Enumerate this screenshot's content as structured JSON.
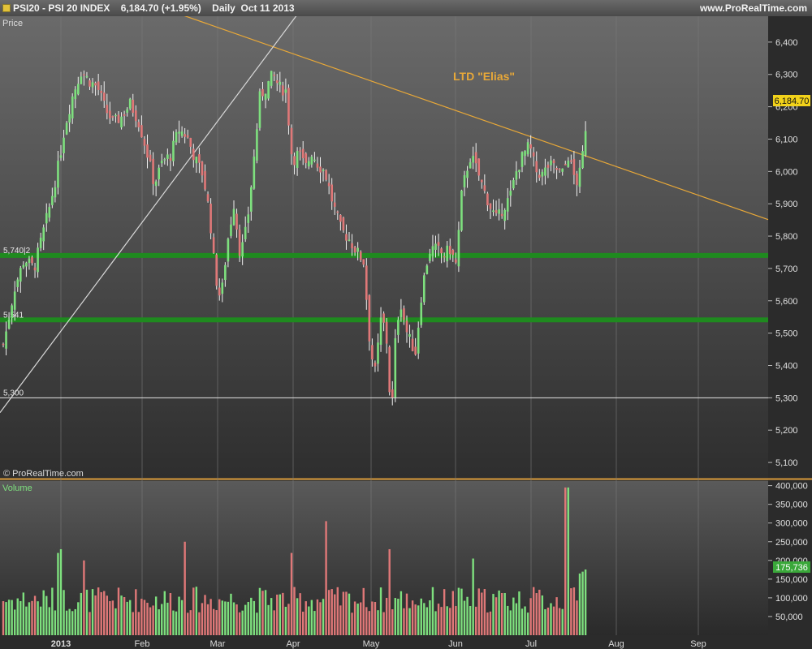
{
  "header": {
    "title": "PSI20 - PSI 20 INDEX",
    "last": "6,184.70 (+1.95%)",
    "period": "Daily  Oct 11 2013",
    "site": "www.ProRealTime.com"
  },
  "panels": {
    "price_label": "Price",
    "volume_label": "Volume",
    "watermark": "© ProRealTime.com",
    "annotation": "LTD \"Elias\""
  },
  "colors": {
    "up": "#7ee07e",
    "down": "#e07878",
    "support": "#1f8a1f",
    "trendline": "#e8a838",
    "uptrend": "#d8d8d8",
    "last_badge": "#f2d21a",
    "vol_badge": "#3aa83a"
  },
  "chart_data": [
    {
      "type": "candlestick",
      "title": "PSI20 - PSI 20 INDEX",
      "ylabel": "Price",
      "ylim": [
        5050,
        6480
      ],
      "y_ticks": [
        5100,
        5200,
        5300,
        5400,
        5500,
        5600,
        5700,
        5800,
        5900,
        6000,
        6100,
        6200,
        6300,
        6400
      ],
      "y_tick_labels": [
        "5,100",
        "5,200",
        "5,300",
        "5,400",
        "5,500",
        "5,600",
        "5,700",
        "5,800",
        "5,900",
        "6,000",
        "6,100",
        "6,200",
        "6,300",
        "6,400"
      ],
      "x_labels": [
        "2013",
        "Feb",
        "Mar",
        "Apr",
        "May",
        "Jun",
        "Jul",
        "Aug",
        "Sep"
      ],
      "last_value": 6184.7,
      "last_value_label": "6,184.70",
      "levels": [
        {
          "value": 5740.2,
          "label": "5,740|2",
          "style": "support"
        },
        {
          "value": 5541,
          "label": "5,541",
          "style": "support"
        },
        {
          "value": 5300,
          "label": "5,300",
          "style": "thin"
        }
      ],
      "close_path": [
        [
          0,
          5420
        ],
        [
          8,
          5510
        ],
        [
          18,
          5640
        ],
        [
          30,
          5730
        ],
        [
          42,
          5700
        ],
        [
          52,
          5800
        ],
        [
          62,
          5900
        ],
        [
          72,
          6020
        ],
        [
          80,
          6140
        ],
        [
          90,
          6240
        ],
        [
          100,
          6310
        ],
        [
          110,
          6280
        ],
        [
          120,
          6260
        ],
        [
          130,
          6190
        ],
        [
          140,
          6150
        ],
        [
          150,
          6170
        ],
        [
          160,
          6210
        ],
        [
          170,
          6160
        ],
        [
          180,
          6070
        ],
        [
          190,
          5960
        ],
        [
          200,
          6030
        ],
        [
          210,
          6050
        ],
        [
          220,
          6130
        ],
        [
          230,
          6110
        ],
        [
          240,
          6040
        ],
        [
          250,
          5990
        ],
        [
          258,
          5870
        ],
        [
          265,
          5680
        ],
        [
          272,
          5600
        ],
        [
          280,
          5780
        ],
        [
          288,
          5900
        ],
        [
          296,
          5740
        ],
        [
          304,
          5830
        ],
        [
          312,
          6020
        ],
        [
          320,
          6230
        ],
        [
          328,
          6260
        ],
        [
          336,
          6300
        ],
        [
          344,
          6260
        ],
        [
          352,
          6250
        ],
        [
          360,
          6030
        ],
        [
          368,
          6060
        ],
        [
          376,
          6010
        ],
        [
          384,
          6060
        ],
        [
          392,
          6020
        ],
        [
          400,
          6000
        ],
        [
          410,
          5900
        ],
        [
          420,
          5820
        ],
        [
          430,
          5790
        ],
        [
          440,
          5750
        ],
        [
          448,
          5720
        ],
        [
          456,
          5450
        ],
        [
          462,
          5380
        ],
        [
          470,
          5560
        ],
        [
          476,
          5480
        ],
        [
          482,
          5230
        ],
        [
          488,
          5530
        ],
        [
          494,
          5590
        ],
        [
          500,
          5510
        ],
        [
          506,
          5470
        ],
        [
          512,
          5440
        ],
        [
          518,
          5600
        ],
        [
          524,
          5700
        ],
        [
          530,
          5760
        ],
        [
          538,
          5760
        ],
        [
          546,
          5740
        ],
        [
          554,
          5760
        ],
        [
          562,
          5710
        ],
        [
          568,
          5920
        ],
        [
          574,
          6000
        ],
        [
          580,
          6050
        ],
        [
          588,
          6000
        ],
        [
          596,
          5940
        ],
        [
          604,
          5890
        ],
        [
          612,
          5850
        ],
        [
          620,
          5890
        ],
        [
          628,
          5920
        ],
        [
          636,
          6000
        ],
        [
          644,
          6050
        ],
        [
          652,
          6080
        ],
        [
          660,
          6000
        ],
        [
          668,
          5990
        ],
        [
          676,
          6020
        ],
        [
          684,
          6010
        ],
        [
          692,
          5990
        ],
        [
          700,
          6050
        ],
        [
          706,
          5990
        ],
        [
          712,
          5960
        ],
        [
          718,
          6060
        ],
        [
          723,
          6185
        ]
      ],
      "volume": {
        "ylim": [
          0,
          410000
        ],
        "y_ticks": [
          50000,
          100000,
          150000,
          200000,
          250000,
          300000,
          350000,
          400000
        ],
        "y_tick_labels": [
          "50,000",
          "100,000",
          "150,000",
          "200,000",
          "250,000",
          "300,000",
          "350,000",
          "400,000"
        ],
        "last_value_label": "175,736",
        "spikes": [
          [
            72,
            220000
          ],
          [
            76,
            230000
          ],
          [
            102,
            200000
          ],
          [
            228,
            250000
          ],
          [
            358,
            220000
          ],
          [
            402,
            305000
          ],
          [
            480,
            230000
          ],
          [
            582,
            205000
          ],
          [
            698,
            395000
          ],
          [
            714,
            165000
          ],
          [
            718,
            170000
          ],
          [
            722,
            175736
          ]
        ]
      },
      "trendlines": [
        {
          "name": "LTD \"Elias\"",
          "points": [
            [
              215,
              6492
            ],
            [
              946,
              5851
            ]
          ]
        },
        {
          "name": "uptrend",
          "points": [
            [
              0,
              5254
            ],
            [
              380,
              6532
            ]
          ]
        }
      ]
    }
  ]
}
